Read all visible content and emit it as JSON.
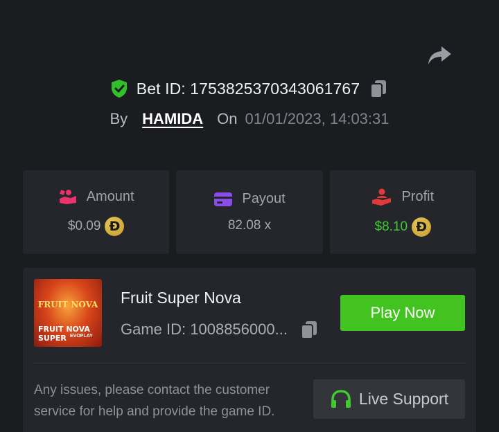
{
  "bet": {
    "id_text": "Bet ID: 1753825370343061767",
    "by_label": "By",
    "username": "HAMIDA",
    "on_label": "On",
    "date": "01/01/2023, 14:03:31"
  },
  "stats": {
    "amount": {
      "label": "Amount",
      "value": "$0.09",
      "icon": "hand-coins-icon",
      "icon_color": "#e8336b"
    },
    "payout": {
      "label": "Payout",
      "value": "82.08 x",
      "icon": "wallet-card-icon",
      "icon_color": "#8b4dea"
    },
    "profit": {
      "label": "Profit",
      "value": "$8.10",
      "icon": "hand-user-icon",
      "icon_color": "#e23a3a"
    },
    "currency_symbol": "Ð"
  },
  "game": {
    "title": "Fruit Super Nova",
    "id_text": "Game ID: 1008856000...",
    "thumb_title": "FRUIT NOVA",
    "thumb_line1": "FRUIT NOVA",
    "thumb_line2": "SUPER",
    "thumb_brand": "EVOPLAY",
    "play_label": "Play Now"
  },
  "support": {
    "text": "Any issues, please contact the customer service for help and provide the game ID.",
    "button_label": "Live Support"
  },
  "colors": {
    "background": "#1b1c20",
    "card": "#25262b",
    "accent_green": "#42c31f",
    "profit_green": "#3ecb2c"
  }
}
